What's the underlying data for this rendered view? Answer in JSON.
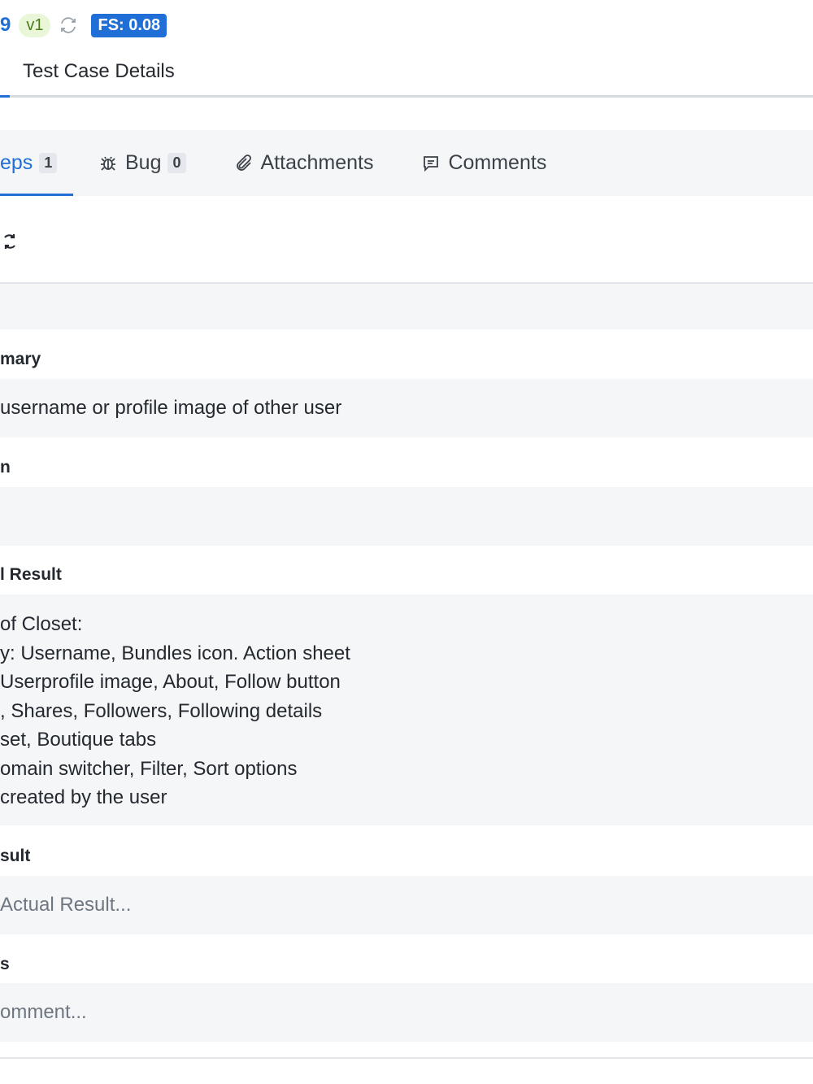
{
  "header": {
    "id_fragment": "9",
    "version": "v1",
    "fs_badge": "FS: 0.08",
    "tab_title": "Test Case Details"
  },
  "tabs": [
    {
      "label": "eps",
      "count": "1",
      "icon": "steps"
    },
    {
      "label": "Bug",
      "count": "0",
      "icon": "bug-icon"
    },
    {
      "label": "Attachments",
      "icon": "paperclip-icon"
    },
    {
      "label": "Comments",
      "icon": "comment-icon"
    }
  ],
  "fields": {
    "summary": {
      "label": "mary",
      "value": " username or profile image of other user"
    },
    "precondition": {
      "label": "n",
      "value": ""
    },
    "expected": {
      "label": "l Result",
      "lines": [
        " of Closet:",
        "y: Username, Bundles icon. Action sheet",
        " Userprofile image, About, Follow button",
        ", Shares, Followers, Following details",
        "set, Boutique tabs",
        "omain switcher, Filter, Sort options",
        " created by the user"
      ]
    },
    "actual": {
      "label": "sult",
      "placeholder": "Actual Result..."
    },
    "comments": {
      "label": "s",
      "placeholder": "omment..."
    }
  },
  "colors": {
    "accent": "#1f6fd6",
    "version_bg": "#e9f7d8",
    "field_bg": "#f5f6f8"
  }
}
